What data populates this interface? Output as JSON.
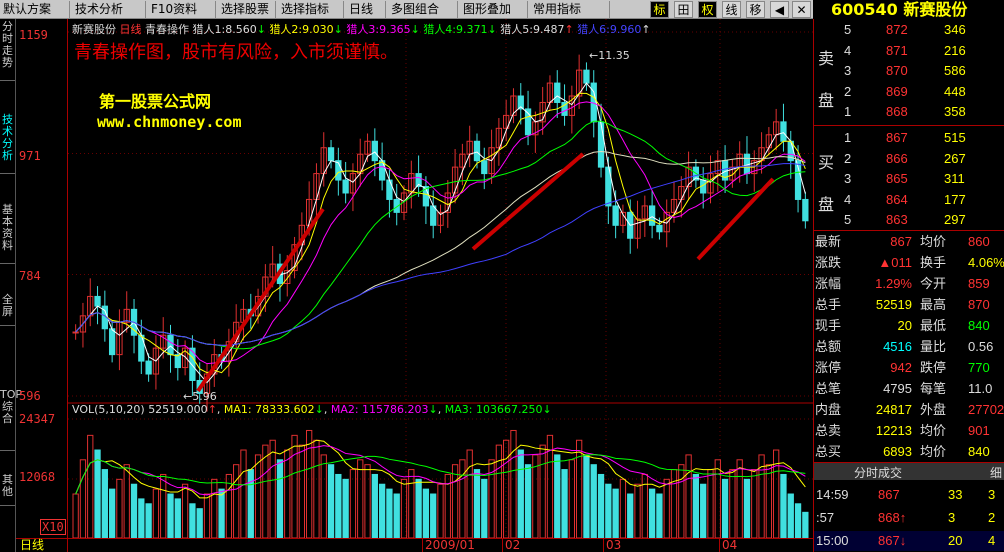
{
  "toolbar": {
    "items": [
      "默认方案",
      "技术分析",
      "F10资料",
      "选择股票",
      "选择指标",
      "日线",
      "多图组合",
      "图形叠加",
      "常用指标"
    ],
    "icons": [
      "标",
      "田",
      "权",
      "线",
      "移"
    ]
  },
  "stock": {
    "code": "600540",
    "name": "新赛股份"
  },
  "left_tabs": [
    "分时走势",
    "技术分析",
    "基本资料",
    "全屏",
    "TOP综合",
    "其他"
  ],
  "legend": {
    "stock": "新赛股份",
    "period": "日线",
    "indicator": "青春操作",
    "items": [
      {
        "label": "猎人1:",
        "value": "8.560",
        "dir": "↓"
      },
      {
        "label": "猎人2:",
        "value": "9.030",
        "dir": "↓"
      },
      {
        "label": "猎人3:",
        "value": "9.365",
        "dir": "↓"
      },
      {
        "label": "猎人4:",
        "value": "9.371",
        "dir": "↓"
      },
      {
        "label": "猎人5:",
        "value": "9.487",
        "dir": "↑"
      },
      {
        "label": "猎人6:",
        "value": "9.960",
        "dir": "↑"
      }
    ]
  },
  "warning": "青春操作图，股市有风险，入市须谨慎。",
  "watermark": {
    "name": "第一股票公式网",
    "url": "www.chnmoney.com"
  },
  "annotations": {
    "high": "11.35",
    "low": "5.96"
  },
  "vol_legend": {
    "label": "VOL(5,10,20)",
    "vol": "52519.000",
    "dir": "↑",
    "ma1": "MA1: 78333.602",
    "ma1d": "↓",
    "ma2": "MA2: 115786.203",
    "ma2d": "↓",
    "ma3": "MA3: 103667.250",
    "ma3d": "↓"
  },
  "yaxis": {
    "price": [
      "1159",
      "971",
      "784",
      "596"
    ],
    "volume": [
      "24347",
      "12068"
    ],
    "unit": "X10"
  },
  "xaxis": {
    "period": "日线",
    "labels": [
      "2009/01",
      "02",
      "03",
      "04"
    ]
  },
  "colors": {
    "bg": "#000000",
    "up": "#e03030",
    "down": "#40e0e0",
    "axis": "#aa0000"
  },
  "chart_data": [
    {
      "type": "candlestick",
      "title": "新赛股份 日线 青春操作",
      "ylim": [
        5.96,
        11.59
      ],
      "ticks": [
        5.96,
        7.84,
        9.71,
        11.59
      ],
      "close": [
        6.95,
        7.2,
        7.5,
        7.35,
        7.0,
        6.6,
        7.1,
        7.3,
        6.9,
        6.5,
        6.3,
        6.7,
        6.9,
        6.6,
        6.4,
        6.7,
        6.2,
        6.0,
        6.3,
        6.6,
        6.5,
        6.8,
        7.1,
        7.3,
        7.2,
        7.5,
        7.8,
        8.0,
        7.7,
        7.9,
        8.3,
        8.6,
        9.0,
        9.4,
        9.8,
        9.6,
        9.3,
        9.1,
        9.4,
        9.7,
        9.9,
        9.6,
        9.3,
        9.0,
        8.8,
        9.1,
        9.4,
        9.2,
        8.9,
        8.6,
        8.8,
        9.1,
        9.5,
        9.7,
        9.9,
        9.6,
        9.4,
        9.8,
        10.1,
        10.3,
        10.6,
        10.4,
        10.0,
        10.2,
        10.5,
        10.8,
        10.5,
        10.3,
        10.6,
        11.0,
        10.8,
        10.2,
        9.5,
        8.9,
        8.6,
        8.8,
        8.4,
        8.7,
        8.9,
        8.6,
        8.5,
        8.8,
        9.0,
        9.2,
        9.5,
        9.3,
        9.1,
        9.4,
        9.6,
        9.3,
        9.5,
        9.7,
        9.4,
        9.6,
        9.8,
        10.0,
        10.2,
        9.9,
        9.6,
        9.0,
        8.67
      ]
    },
    {
      "type": "bar",
      "title": "VOL(5,10,20)",
      "ylim": [
        0,
        24347
      ],
      "ticks": [
        12068,
        24347
      ],
      "values": [
        9000,
        16000,
        21000,
        18000,
        14000,
        10000,
        12000,
        15000,
        11000,
        8000,
        7000,
        10000,
        13000,
        9000,
        8000,
        11000,
        7000,
        6000,
        9000,
        12000,
        10000,
        13000,
        15000,
        18000,
        14000,
        17000,
        19000,
        20000,
        16000,
        18000,
        21000,
        19000,
        22000,
        20000,
        17000,
        15000,
        13000,
        12000,
        14000,
        16000,
        15000,
        13000,
        11000,
        10000,
        9000,
        12000,
        14000,
        12000,
        10000,
        9000,
        11000,
        13000,
        15000,
        16000,
        18000,
        14000,
        12000,
        16000,
        19000,
        20000,
        22000,
        18000,
        15000,
        17000,
        19000,
        21000,
        17000,
        14000,
        16000,
        20000,
        17000,
        15000,
        13000,
        11000,
        10000,
        12000,
        9000,
        11000,
        13000,
        10000,
        9000,
        12000,
        14000,
        15000,
        17000,
        13000,
        11000,
        14000,
        16000,
        12000,
        14000,
        16000,
        12000,
        14000,
        17000,
        15000,
        18000,
        13000,
        9000,
        7000,
        5252
      ]
    }
  ],
  "orderbook": {
    "sell": [
      {
        "lvl": "5",
        "price": "872",
        "vol": "346"
      },
      {
        "lvl": "4",
        "price": "871",
        "vol": "216"
      },
      {
        "lvl": "3",
        "price": "870",
        "vol": "586"
      },
      {
        "lvl": "2",
        "price": "869",
        "vol": "448"
      },
      {
        "lvl": "1",
        "price": "868",
        "vol": "358"
      }
    ],
    "buy": [
      {
        "lvl": "1",
        "price": "867",
        "vol": "515"
      },
      {
        "lvl": "2",
        "price": "866",
        "vol": "267"
      },
      {
        "lvl": "3",
        "price": "865",
        "vol": "311"
      },
      {
        "lvl": "4",
        "price": "864",
        "vol": "177"
      },
      {
        "lvl": "5",
        "price": "863",
        "vol": "297"
      }
    ],
    "sell_label": [
      "卖",
      "盘"
    ],
    "buy_label": [
      "买",
      "盘"
    ]
  },
  "stats": [
    {
      "l1": "最新",
      "v1": "867",
      "l2": "均价",
      "v2": "860"
    },
    {
      "l1": "涨跌",
      "v1": "▲011",
      "l2": "换手",
      "v2": "4.06%"
    },
    {
      "l1": "涨幅",
      "v1": "1.29%",
      "l2": "今开",
      "v2": "859"
    },
    {
      "l1": "总手",
      "v1": "52519",
      "l2": "最高",
      "v2": "870"
    },
    {
      "l1": "现手",
      "v1": "20",
      "l2": "最低",
      "v2": "840"
    },
    {
      "l1": "总额",
      "v1": "4516",
      "l2": "量比",
      "v2": "0.56"
    },
    {
      "l1": "涨停",
      "v1": "942",
      "l2": "跌停",
      "v2": "770"
    },
    {
      "l1": "总笔",
      "v1": "4795",
      "l2": "每笔",
      "v2": "11.0"
    },
    {
      "l1": "内盘",
      "v1": "24817",
      "l2": "外盘",
      "v2": "27702"
    },
    {
      "l1": "总卖",
      "v1": "12213",
      "l2": "均价",
      "v2": "901"
    },
    {
      "l1": "总买",
      "v1": "6893",
      "l2": "均价",
      "v2": "840"
    }
  ],
  "trade_tabs": [
    "分时成交",
    "细"
  ],
  "trades": [
    {
      "time": "14:59",
      "price": "867",
      "vol": "33",
      "n": "3"
    },
    {
      "time": ":57",
      "price": "868↑",
      "vol": "3",
      "n": "2"
    },
    {
      "time": "15:00",
      "price": "867↓",
      "vol": "20",
      "n": "4"
    }
  ]
}
